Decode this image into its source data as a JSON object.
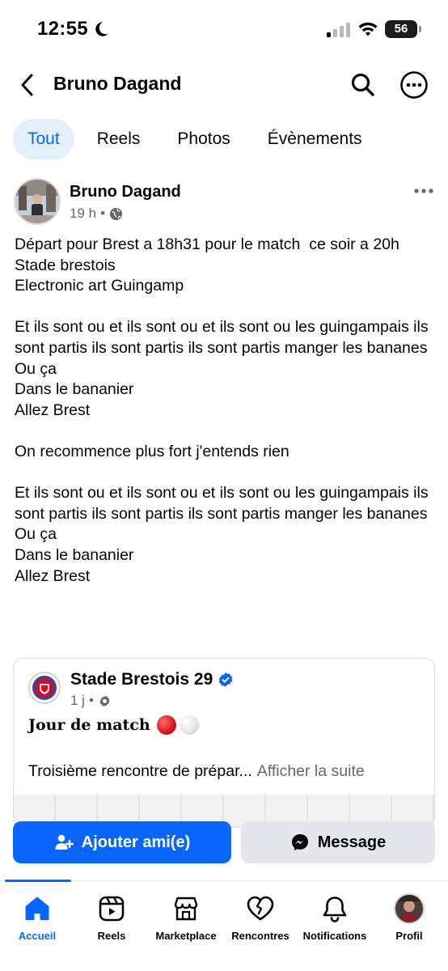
{
  "status_bar": {
    "time": "12:55",
    "battery": "56",
    "icons": [
      "moon-icon",
      "signal-icon",
      "wifi-icon",
      "battery-icon"
    ]
  },
  "header": {
    "title": "Bruno Dagand",
    "icons": [
      "back-arrow-icon",
      "search-icon",
      "more-horizontal-icon"
    ]
  },
  "tabs": [
    {
      "label": "Tout",
      "active": true
    },
    {
      "label": "Reels",
      "active": false
    },
    {
      "label": "Photos",
      "active": false
    },
    {
      "label": "Évènements",
      "active": false
    }
  ],
  "post": {
    "author": "Bruno Dagand",
    "time": "19 h",
    "separator": "•",
    "audience_icon": "globe-icon",
    "text": "Départ pour Brest a 18h31 pour le match  ce soir a 20h\nStade brestois\nElectronic art Guingamp\n\nEt ils sont ou et ils sont ou et ils sont ou les guingampais ils sont partis ils sont partis ils sont partis manger les bananes\nOu ça\nDans le bananier\nAllez Brest\n\nOn recommence plus fort j'entends rien\n\nEt ils sont ou et ils sont ou et ils sont ou les guingampais ils sont partis ils sont partis ils sont partis manger les bananes\nOu ça\nDans le bananier\nAllez Brest"
  },
  "shared_post": {
    "page_name": "Stade Brestois 29",
    "verified_icon": "verified-badge-icon",
    "time": "1 j",
    "separator": "•",
    "audience_icon": "gear-icon",
    "headline": "Jour de match",
    "snippet": "Troisième rencontre de prépar...",
    "see_more": "Afficher la suite"
  },
  "actions": {
    "add_friend": "Ajouter ami(e)",
    "message": "Message",
    "colors": {
      "primary": "#0866ff",
      "secondary": "#e4e6eb"
    }
  },
  "bottom_nav": {
    "items": [
      {
        "label": "Accueil",
        "icon": "home-icon",
        "active": true
      },
      {
        "label": "Reels",
        "icon": "reels-icon",
        "active": false
      },
      {
        "label": "Marketplace",
        "icon": "marketplace-icon",
        "active": false
      },
      {
        "label": "Rencontres",
        "icon": "dating-heart-icon",
        "active": false
      },
      {
        "label": "Notifications",
        "icon": "bell-icon",
        "active": false
      },
      {
        "label": "Profil",
        "icon": "profile-avatar",
        "active": false
      }
    ]
  }
}
